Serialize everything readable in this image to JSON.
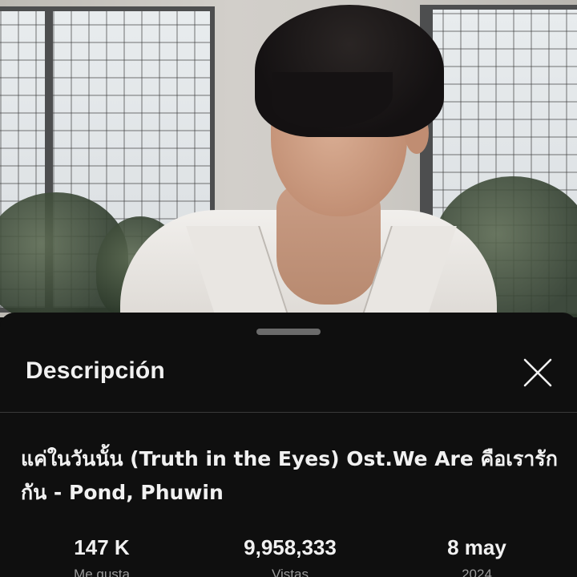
{
  "sheet": {
    "title": "Descripción",
    "close_icon": "close-icon"
  },
  "video": {
    "title": "แค่ในวันนั้น (Truth in the Eyes) Ost.We Are คือเรารักกัน - Pond, Phuwin"
  },
  "stats": [
    {
      "value": "147 K",
      "label": "Me gusta"
    },
    {
      "value": "9,958,333",
      "label": "Vistas"
    },
    {
      "value": "8 may",
      "label": "2024"
    }
  ],
  "colors": {
    "background": "#0f0f0f",
    "text_primary": "#f1f1f1",
    "text_secondary": "#9a9a9a",
    "handle": "#6b6b6b"
  }
}
